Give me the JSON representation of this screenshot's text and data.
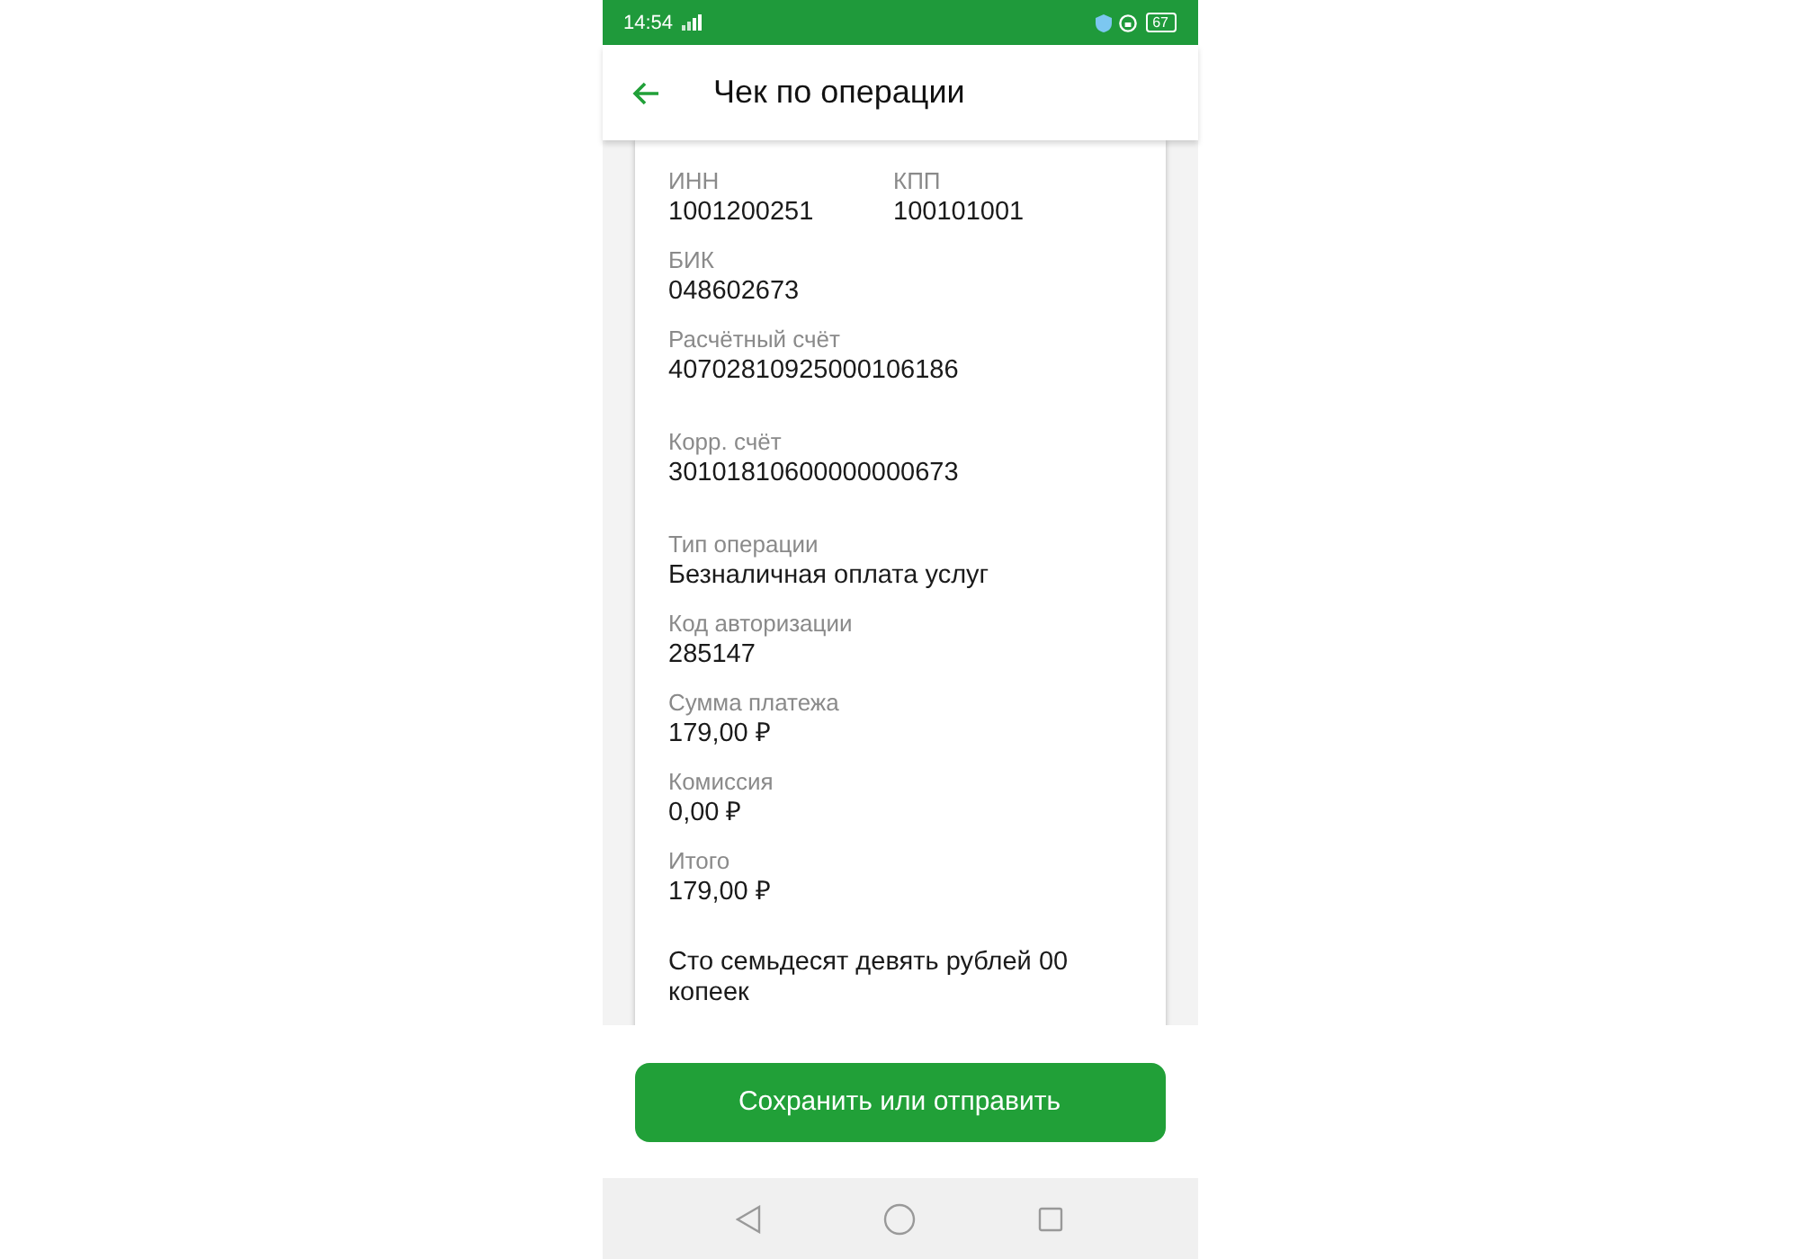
{
  "status_bar": {
    "time": "14:54",
    "battery": "67"
  },
  "header": {
    "title": "Чек по операции"
  },
  "receipt": {
    "sections": [
      {
        "rows": [
          [
            {
              "label": "ИНН",
              "value": "1001200251"
            },
            {
              "label": "КПП",
              "value": "100101001"
            }
          ],
          [
            {
              "label": "БИК",
              "value": "048602673"
            }
          ],
          [
            {
              "label": "Расчётный счёт",
              "value": "40702810925000106186"
            }
          ]
        ]
      },
      {
        "rows": [
          [
            {
              "label": "Корр. счёт",
              "value": "30101810600000000673"
            }
          ]
        ]
      },
      {
        "rows": [
          [
            {
              "label": "Тип операции",
              "value": "Безналичная оплата услуг"
            }
          ],
          [
            {
              "label": "Код авторизации",
              "value": "285147"
            }
          ],
          [
            {
              "label": "Сумма платежа",
              "value": "179,00 ₽"
            }
          ],
          [
            {
              "label": "Комиссия",
              "value": "0,00 ₽"
            }
          ],
          [
            {
              "label": "Итого",
              "value": "179,00 ₽"
            }
          ]
        ]
      }
    ],
    "amount_in_words": "Сто семьдесят девять рублей 00 копеек"
  },
  "action_button": "Сохранить или отправить"
}
